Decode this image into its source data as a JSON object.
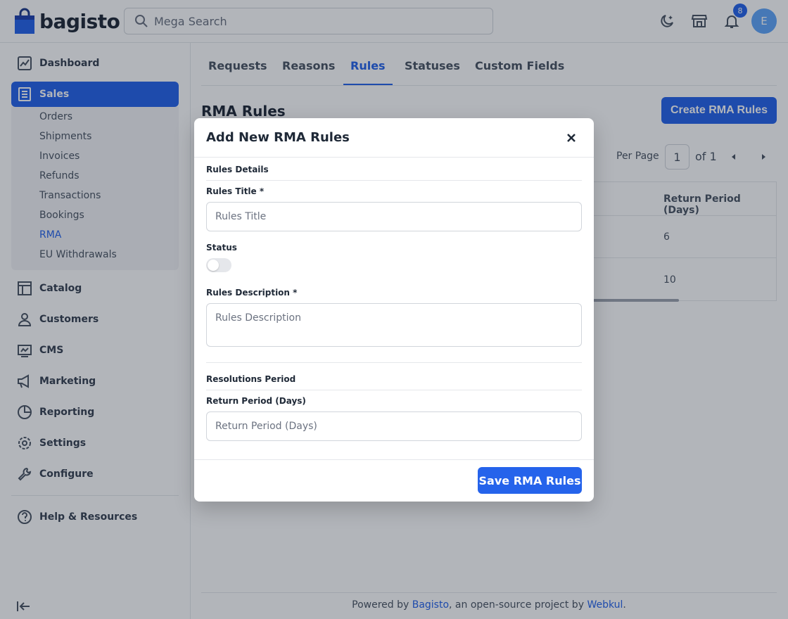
{
  "header": {
    "logo_text": "bagisto",
    "search_placeholder": "Mega Search",
    "notification_count": "8",
    "avatar_initial": "E"
  },
  "sidebar": {
    "items": [
      {
        "label": "Dashboard",
        "icon": "dashboard-icon"
      },
      {
        "label": "Sales",
        "icon": "sales-icon",
        "active": true
      },
      {
        "label": "Catalog",
        "icon": "catalog-icon"
      },
      {
        "label": "Customers",
        "icon": "customers-icon"
      },
      {
        "label": "CMS",
        "icon": "cms-icon"
      },
      {
        "label": "Marketing",
        "icon": "marketing-icon"
      },
      {
        "label": "Reporting",
        "icon": "reporting-icon"
      },
      {
        "label": "Settings",
        "icon": "settings-icon"
      },
      {
        "label": "Configure",
        "icon": "configure-icon"
      },
      {
        "label": "Help & Resources",
        "icon": "help-icon"
      }
    ],
    "sales_sub": [
      "Orders",
      "Shipments",
      "Invoices",
      "Refunds",
      "Transactions",
      "Bookings",
      "RMA",
      "EU Withdrawals"
    ],
    "active_sub": "RMA"
  },
  "tabs": [
    "Requests",
    "Reasons",
    "Rules",
    "Statuses",
    "Custom Fields"
  ],
  "active_tab": "Rules",
  "page": {
    "title": "RMA Rules",
    "create_button": "Create RMA Rules",
    "per_page_label": "Per Page",
    "page_number": "1",
    "page_of": "of 1"
  },
  "table": {
    "header": "Return Period (Days)",
    "rows": [
      "6",
      "10"
    ]
  },
  "modal": {
    "title": "Add New RMA Rules",
    "section1": "Rules Details",
    "title_label": "Rules Title *",
    "title_placeholder": "Rules Title",
    "status_label": "Status",
    "status_on": false,
    "desc_label": "Rules Description *",
    "desc_placeholder": "Rules Description",
    "section2": "Resolutions Period",
    "period_label": "Return Period (Days)",
    "period_placeholder": "Return Period (Days)",
    "save_button": "Save RMA Rules"
  },
  "footer": {
    "prefix": "Powered by ",
    "link1": "Bagisto",
    "middle": ", an open-source project by ",
    "link2": "Webkul",
    "suffix": "."
  },
  "colors": {
    "accent": "#2563eb",
    "overlay": "rgba(17,24,39,0.32)"
  }
}
